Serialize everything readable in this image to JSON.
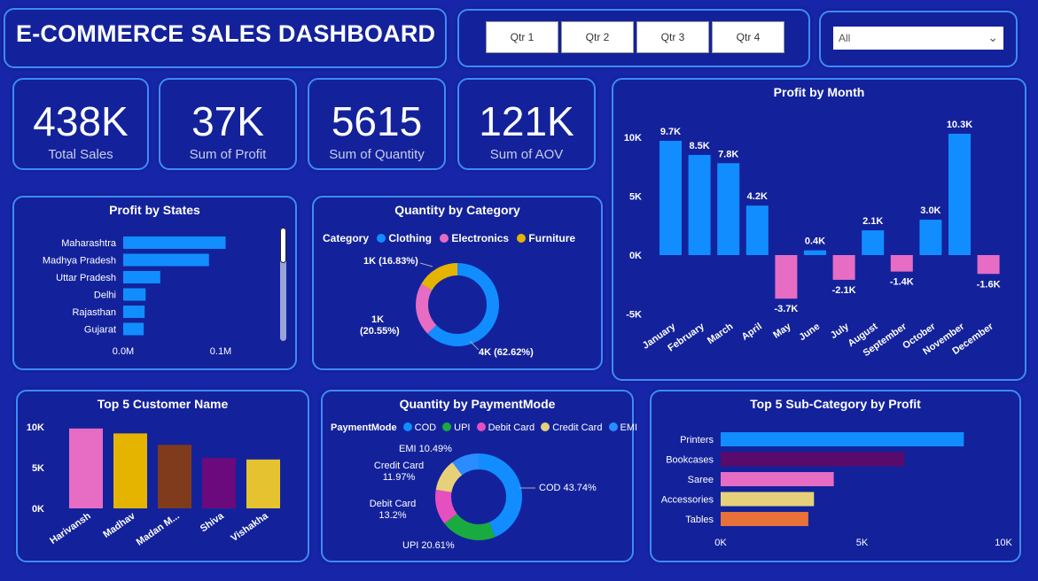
{
  "header": {
    "title": "E-COMMERCE SALES DASHBOARD"
  },
  "quarters": [
    "Qtr 1",
    "Qtr 2",
    "Qtr 3",
    "Qtr 4"
  ],
  "filter": {
    "value": "All"
  },
  "kpis": [
    {
      "value": "438K",
      "label": "Total Sales"
    },
    {
      "value": "37K",
      "label": "Sum of Profit"
    },
    {
      "value": "5615",
      "label": "Sum of Quantity"
    },
    {
      "value": "121K",
      "label": "Sum of AOV"
    }
  ],
  "colors": {
    "blue": "#118dff",
    "pink": "#e66cc4",
    "green": "#1aab40",
    "yellow": "#e5b400",
    "panel_border": "#3d8bff"
  },
  "chart_data": [
    {
      "id": "profit_by_month",
      "type": "bar",
      "title": "Profit by Month",
      "categories": [
        "January",
        "February",
        "March",
        "April",
        "May",
        "June",
        "July",
        "August",
        "September",
        "October",
        "November",
        "December"
      ],
      "values": [
        9700,
        8500,
        7800,
        4200,
        -3700,
        400,
        -2100,
        2100,
        -1400,
        3000,
        10300,
        -1600
      ],
      "data_labels": [
        "9.7K",
        "8.5K",
        "7.8K",
        "4.2K",
        "-3.7K",
        "0.4K",
        "-2.1K",
        "2.1K",
        "-1.4K",
        "3.0K",
        "10.3K",
        "-1.6K"
      ],
      "y_ticks": [
        {
          "v": 10000,
          "t": "10K"
        },
        {
          "v": 5000,
          "t": "5K"
        },
        {
          "v": 0,
          "t": "0K"
        },
        {
          "v": -5000,
          "t": "-5K"
        }
      ],
      "ylim": [
        -5000,
        10000
      ]
    },
    {
      "id": "profit_by_states",
      "type": "bar",
      "orientation": "horizontal",
      "title": "Profit by States",
      "categories": [
        "Maharashtra",
        "Madhya Pradesh",
        "Uttar Pradesh",
        "Delhi",
        "Rajasthan",
        "Gujarat"
      ],
      "values": [
        105000,
        88000,
        38000,
        23000,
        22000,
        21000
      ],
      "x_ticks": [
        {
          "v": 0,
          "t": "0.0M"
        },
        {
          "v": 100000,
          "t": "0.1M"
        }
      ],
      "xlim": [
        0,
        120000
      ]
    },
    {
      "id": "quantity_by_category",
      "type": "pie",
      "title": "Quantity by Category",
      "legend_title": "Category",
      "categories": [
        "Clothing",
        "Electronics",
        "Furniture"
      ],
      "values": [
        62.62,
        20.55,
        16.83
      ],
      "labels": [
        "4K (62.62%)",
        "1K (20.55%)",
        "1K (16.83%)"
      ],
      "colors": [
        "#118dff",
        "#e66cc4",
        "#e5b400"
      ]
    },
    {
      "id": "top5_customer",
      "type": "bar",
      "title": "Top 5 Customer Name",
      "categories": [
        "Harivansh",
        "Madhav",
        "Madan M...",
        "Shiva",
        "Vishakha"
      ],
      "values": [
        9800,
        9200,
        7800,
        6200,
        6000
      ],
      "colors": [
        "#e66cc4",
        "#e5b400",
        "#7f3b1c",
        "#6a0a7c",
        "#e5c22f"
      ],
      "y_ticks": [
        {
          "v": 10000,
          "t": "10K"
        },
        {
          "v": 5000,
          "t": "5K"
        },
        {
          "v": 0,
          "t": "0K"
        }
      ],
      "ylim": [
        0,
        10000
      ]
    },
    {
      "id": "quantity_by_paymentmode",
      "type": "pie",
      "title": "Quantity by PaymentMode",
      "legend_title": "PaymentMode",
      "categories": [
        "COD",
        "UPI",
        "Debit Card",
        "Credit Card",
        "EMI"
      ],
      "values": [
        43.74,
        20.61,
        13.2,
        11.97,
        10.49
      ],
      "labels": [
        "COD 43.74%",
        "UPI 20.61%",
        "Debit Card\n13.2%",
        "Credit Card\n11.97%",
        "EMI 10.49%"
      ],
      "colors": [
        "#118dff",
        "#1aab40",
        "#e64fbf",
        "#e6d17a",
        "#2a8cff"
      ]
    },
    {
      "id": "top5_subcategory",
      "type": "bar",
      "orientation": "horizontal",
      "title": "Top 5 Sub-Category by Profit",
      "categories": [
        "Printers",
        "Bookcases",
        "Saree",
        "Accessories",
        "Tables"
      ],
      "values": [
        8600,
        6500,
        4000,
        3300,
        3100
      ],
      "colors": [
        "#118dff",
        "#5a0a6b",
        "#e66cc4",
        "#e6d17a",
        "#e8713a"
      ],
      "x_ticks": [
        {
          "v": 0,
          "t": "0K"
        },
        {
          "v": 5000,
          "t": "5K"
        },
        {
          "v": 10000,
          "t": "10K"
        }
      ],
      "xlim": [
        0,
        10000
      ]
    }
  ]
}
